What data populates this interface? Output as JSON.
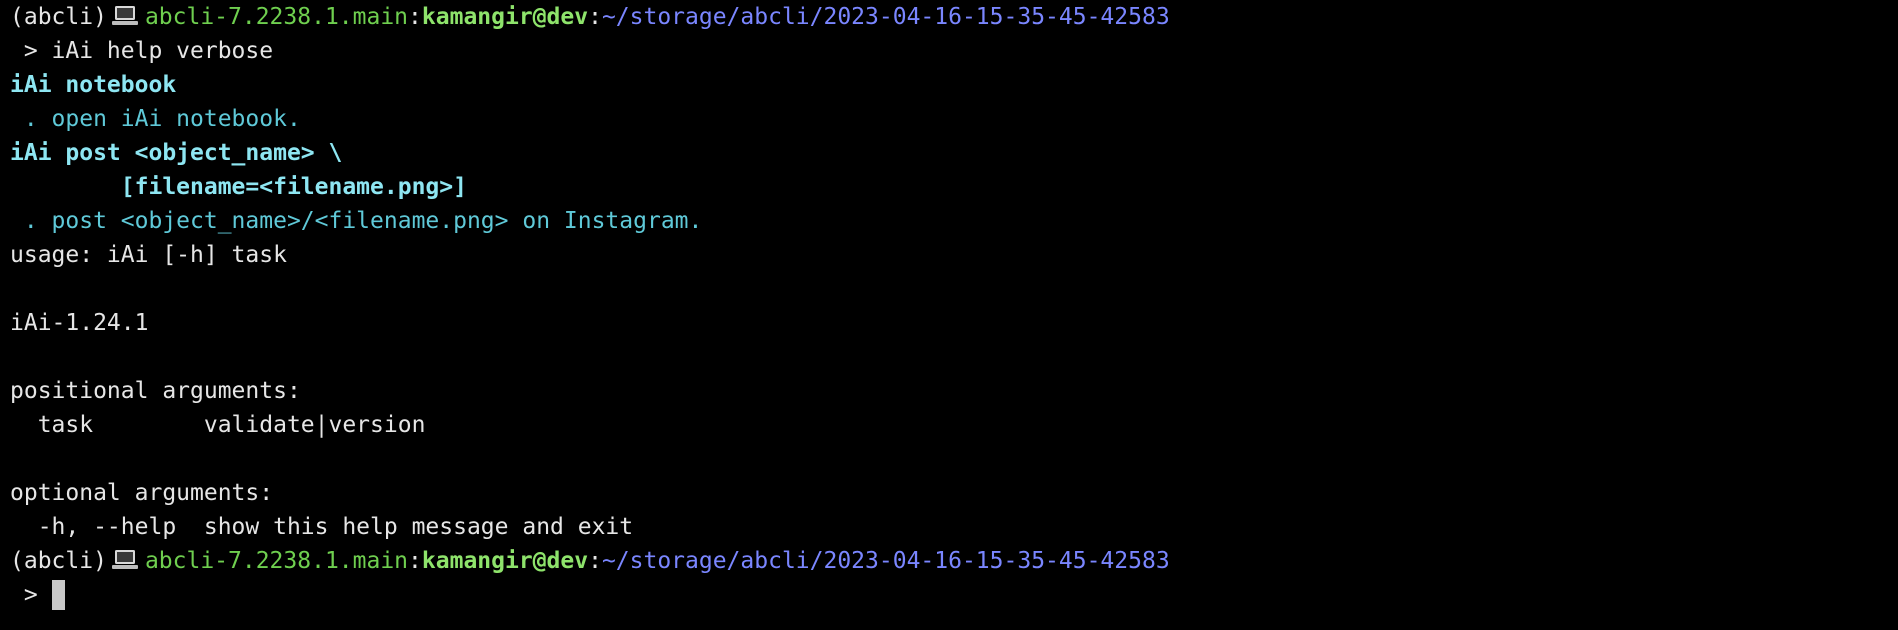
{
  "terminal": {
    "prompt1": {
      "env": "(abcli)",
      "icon": "laptop-icon",
      "version": "abcli-7.2238.1.main",
      "sep1": ":",
      "user_host": "kamangir@dev",
      "sep2": ":",
      "path": "~/storage/abcli/2023-04-16-15-35-45-42583"
    },
    "command1": " > iAi help verbose",
    "help": {
      "notebook_cmd": "iAi notebook",
      "notebook_desc": " . open iAi notebook.",
      "post_cmd": "iAi post <object_name> \\",
      "post_cmd_cont": "        [filename=<filename.png>]",
      "post_desc": " . post <object_name>/<filename.png> on Instagram."
    },
    "usage": {
      "usage_line": "usage: iAi [-h] task",
      "version_line": "iAi-1.24.1",
      "positional_header": "positional arguments:",
      "positional_arg": "  task        validate|version",
      "optional_header": "optional arguments:",
      "optional_arg": "  -h, --help  show this help message and exit"
    },
    "prompt2": {
      "env": "(abcli)",
      "icon": "laptop-icon",
      "version": "abcli-7.2238.1.main",
      "sep1": ":",
      "user_host": "kamangir@dev",
      "sep2": ":",
      "path": "~/storage/abcli/2023-04-16-15-35-45-42583"
    },
    "command2": " > "
  },
  "colors": {
    "background": "#000000",
    "text": "#e6e6e6",
    "green": "#6fcf4f",
    "green_bold": "#8ee36b",
    "blue": "#7a86ff",
    "cyan": "#5fc9d8",
    "cyan_bold": "#8ee6f2"
  }
}
